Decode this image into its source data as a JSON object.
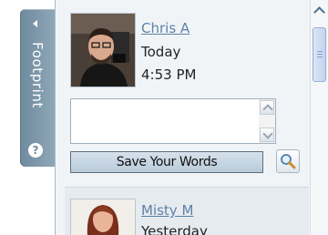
{
  "side_tab": {
    "label": "Footprint",
    "help_glyph": "?",
    "arrow_icon": "triangle-left-icon"
  },
  "entries": [
    {
      "name": "Chris A",
      "day": "Today",
      "time": "4:53 PM",
      "avatar": "profile-photo-man"
    },
    {
      "name": "Misty M",
      "day": "Yesterday",
      "avatar": "profile-photo-woman"
    }
  ],
  "words_input": {
    "value": "",
    "placeholder": ""
  },
  "save_button": {
    "label": "Save Your Words"
  },
  "icons": {
    "search": "magnifier-icon",
    "scroll_up": "chevron-up-icon"
  },
  "colors": {
    "tab": "#7f98ab",
    "link": "#5e82a8",
    "button": "#c6d5e2",
    "panel": "#f1f4f7"
  }
}
